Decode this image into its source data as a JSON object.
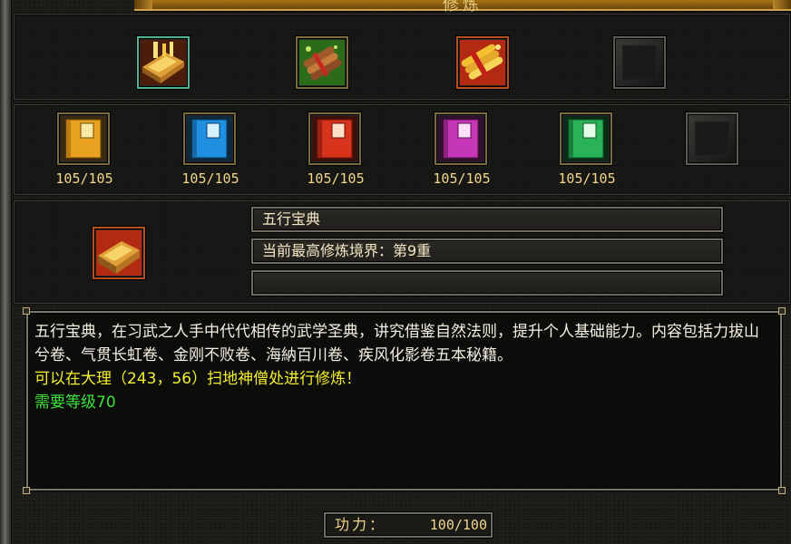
{
  "window": {
    "title": "修炼"
  },
  "top_row": [
    {
      "name": "wuxing-book",
      "empty": false
    },
    {
      "name": "scroll-bundle-red",
      "empty": false
    },
    {
      "name": "scroll-bundle-gold",
      "empty": false
    },
    {
      "name": "empty-slot",
      "empty": true
    }
  ],
  "books": [
    {
      "name": "yellow-book",
      "color": "#e8a21f",
      "count": "105/105"
    },
    {
      "name": "blue-book",
      "color": "#1f8fe0",
      "count": "105/105"
    },
    {
      "name": "red-book",
      "color": "#d8331d",
      "count": "105/105"
    },
    {
      "name": "purple-book",
      "color": "#c637b7",
      "count": "105/105"
    },
    {
      "name": "green-book",
      "color": "#29b257",
      "count": "105/105"
    }
  ],
  "detail": {
    "name": "五行宝典",
    "realm": "当前最高修炼境界：第9重",
    "extra": ""
  },
  "description": {
    "text": "五行宝典，在习武之人手中代代相传的武学圣典，讲究借鉴自然法则，提升个人基础能力。内容包括力拔山兮卷、气贯长虹卷、金刚不败卷、海納百川卷、疾风化影卷五本秘籍。",
    "location": "可以在大理（243，56）扫地神僧处进行修炼！",
    "requirement": "需要等级70"
  },
  "power": {
    "label": "功力：",
    "value": "100/100"
  }
}
